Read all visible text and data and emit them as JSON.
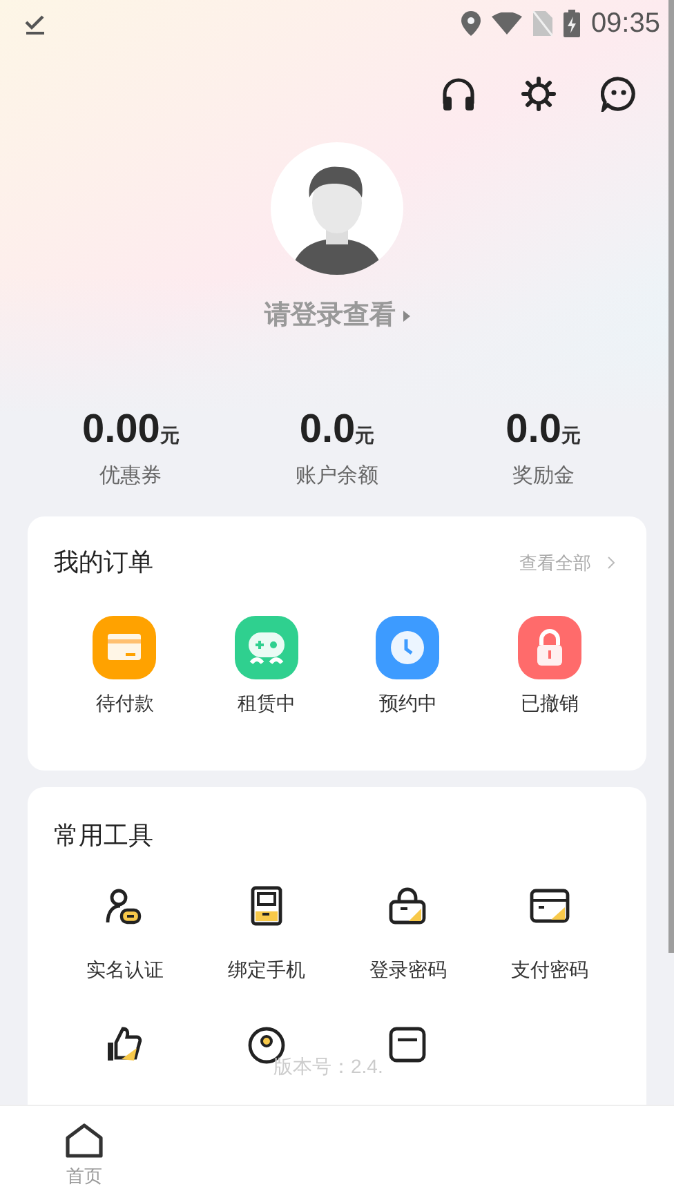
{
  "status_bar": {
    "time": "09:35"
  },
  "profile": {
    "login_prompt": "请登录查看"
  },
  "stats": [
    {
      "amount": "0.00",
      "unit": "元",
      "label": "优惠券"
    },
    {
      "amount": "0.0",
      "unit": "元",
      "label": "账户余额"
    },
    {
      "amount": "0.0",
      "unit": "元",
      "label": "奖励金"
    }
  ],
  "orders": {
    "title": "我的订单",
    "view_all": "查看全部",
    "items": [
      {
        "label": "待付款",
        "kind": "card",
        "color": "#ffa200"
      },
      {
        "label": "租赁中",
        "kind": "gamepad",
        "color": "#2fd08f"
      },
      {
        "label": "预约中",
        "kind": "clock",
        "color": "#3d9bff"
      },
      {
        "label": "已撤销",
        "kind": "lock",
        "color": "#ff6b6b"
      }
    ]
  },
  "tools": {
    "title": "常用工具",
    "items": [
      {
        "label": "实名认证",
        "kind": "person"
      },
      {
        "label": "绑定手机",
        "kind": "phone"
      },
      {
        "label": "登录密码",
        "kind": "lock"
      },
      {
        "label": "支付密码",
        "kind": "card"
      },
      {
        "kind": "thumb"
      },
      {
        "kind": "ring"
      },
      {
        "kind": "box"
      }
    ]
  },
  "version_text": "版本号：2.4.",
  "bottom_nav": [
    {
      "label": "首页",
      "selected": false
    }
  ]
}
